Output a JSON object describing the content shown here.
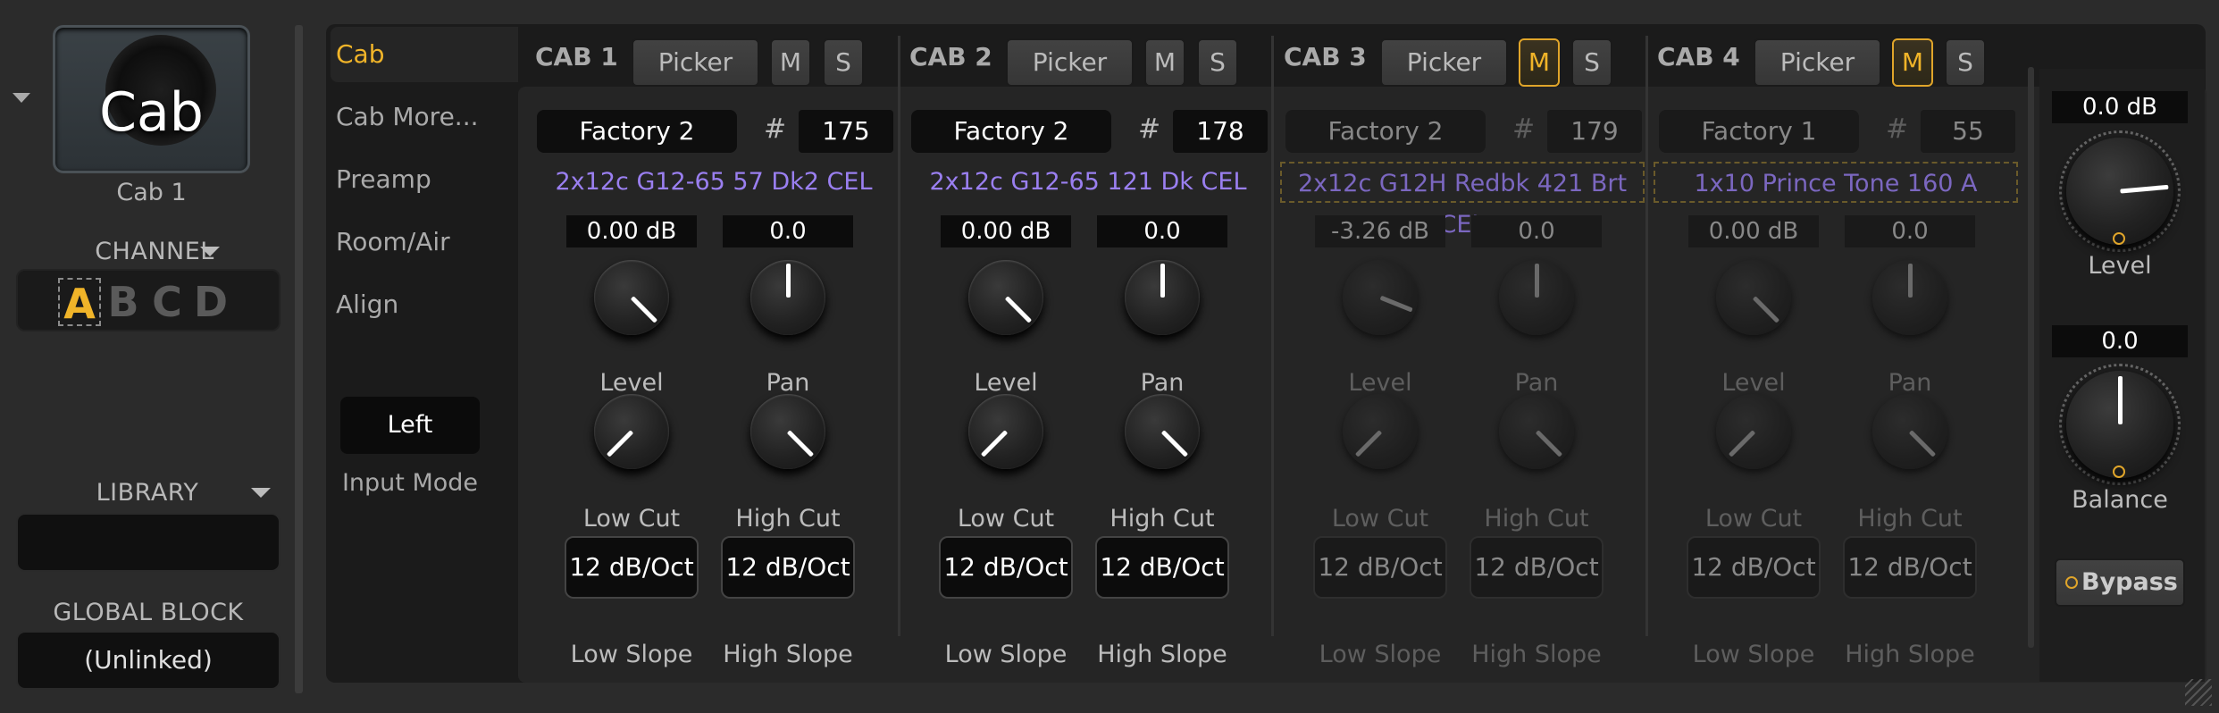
{
  "block": {
    "tile_label": "Cab",
    "name": "Cab 1"
  },
  "channel": {
    "label": "CHANNEL",
    "options": [
      "A",
      "B",
      "C",
      "D"
    ],
    "active": "A"
  },
  "library": {
    "label": "LIBRARY",
    "value": ""
  },
  "global_block": {
    "label": "GLOBAL BLOCK",
    "value": "(Unlinked)"
  },
  "tabs": [
    {
      "label": "Cab",
      "active": true
    },
    {
      "label": "Cab More..."
    },
    {
      "label": "Preamp"
    },
    {
      "label": "Room/Air"
    },
    {
      "label": "Align"
    }
  ],
  "input_mode": {
    "value": "Left",
    "label": "Input Mode"
  },
  "buttons": {
    "picker": "Picker",
    "mute": "M",
    "solo": "S"
  },
  "labels": {
    "hash": "#",
    "level": "Level",
    "pan": "Pan",
    "low_cut": "Low Cut",
    "high_cut": "High Cut",
    "low_slope": "Low Slope",
    "high_slope": "High Slope"
  },
  "cabs": [
    {
      "title": "CAB 1",
      "mute_on": false,
      "bank": "Factory 2",
      "number": "175",
      "ir": "2x12c G12-65 57 Dk2 CEL",
      "level": "0.00 dB",
      "pan": "0.0",
      "low_slope": "12 dB/Oct",
      "high_slope": "12 dB/Oct",
      "dim": false
    },
    {
      "title": "CAB 2",
      "mute_on": false,
      "bank": "Factory 2",
      "number": "178",
      "ir": "2x12c G12-65 121 Dk CEL",
      "level": "0.00 dB",
      "pan": "0.0",
      "low_slope": "12 dB/Oct",
      "high_slope": "12 dB/Oct",
      "dim": false
    },
    {
      "title": "CAB 3",
      "mute_on": true,
      "bank": "Factory 2",
      "number": "179",
      "ir": "2x12c G12H Redbk 421 Brt CEL",
      "level": "-3.26 dB",
      "pan": "0.0",
      "low_slope": "12 dB/Oct",
      "high_slope": "12 dB/Oct",
      "dim": true
    },
    {
      "title": "CAB 4",
      "mute_on": true,
      "bank": "Factory 1",
      "number": "55",
      "ir": "1x10 Prince Tone 160 A",
      "level": "0.00 dB",
      "pan": "0.0",
      "low_slope": "12 dB/Oct",
      "high_slope": "12 dB/Oct",
      "dim": true
    }
  ],
  "master": {
    "level_value": "0.0 dB",
    "level_label": "Level",
    "balance_value": "0.0",
    "balance_label": "Balance",
    "bypass": "Bypass"
  },
  "colors": {
    "accent": "#f0b429",
    "ir_name": "#9a7ff0",
    "panel": "#1b1b1b",
    "background": "#2b2b2b"
  }
}
